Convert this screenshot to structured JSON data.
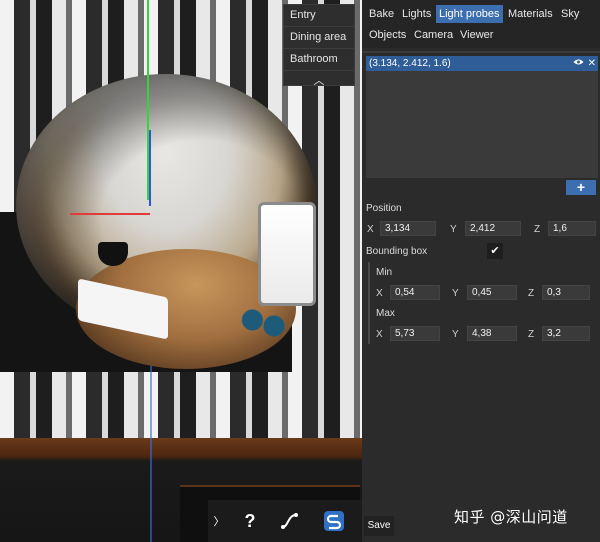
{
  "viewport": {
    "nav": [
      "Entry",
      "Dining area",
      "Bathroom"
    ],
    "collapse_glyph": "︿",
    "toolbar": {
      "expand_glyph": "〉",
      "help_label": "?",
      "curve_icon": "curve-icon",
      "logo_icon": "logo-s-icon"
    }
  },
  "tabs": [
    "Bake",
    "Lights",
    "Light probes",
    "Materials",
    "Sky",
    "Objects",
    "Camera",
    "Viewer"
  ],
  "active_tab": "Light probes",
  "probe_list": {
    "items": [
      {
        "label": "(3.134, 2.412, 1.6)"
      }
    ],
    "eye_icon": "eye-icon",
    "close_icon": "close-icon",
    "add_label": "+"
  },
  "properties": {
    "position_label": "Position",
    "position": {
      "x": "3,134",
      "y": "2,412",
      "z": "1,6"
    },
    "bounding_box_label": "Bounding box",
    "bounding_box_enabled": true,
    "check_glyph": "✔",
    "min_label": "Min",
    "min": {
      "x": "0,54",
      "y": "0,45",
      "z": "0,3"
    },
    "max_label": "Max",
    "max": {
      "x": "5,73",
      "y": "4,38",
      "z": "3,2"
    },
    "axis_x": "X",
    "axis_y": "Y",
    "axis_z": "Z"
  },
  "save_label": "Save",
  "watermark": "知乎 @深山问道",
  "colors": {
    "accent": "#3d6fb0",
    "panel_bg": "#2b2b2b"
  }
}
